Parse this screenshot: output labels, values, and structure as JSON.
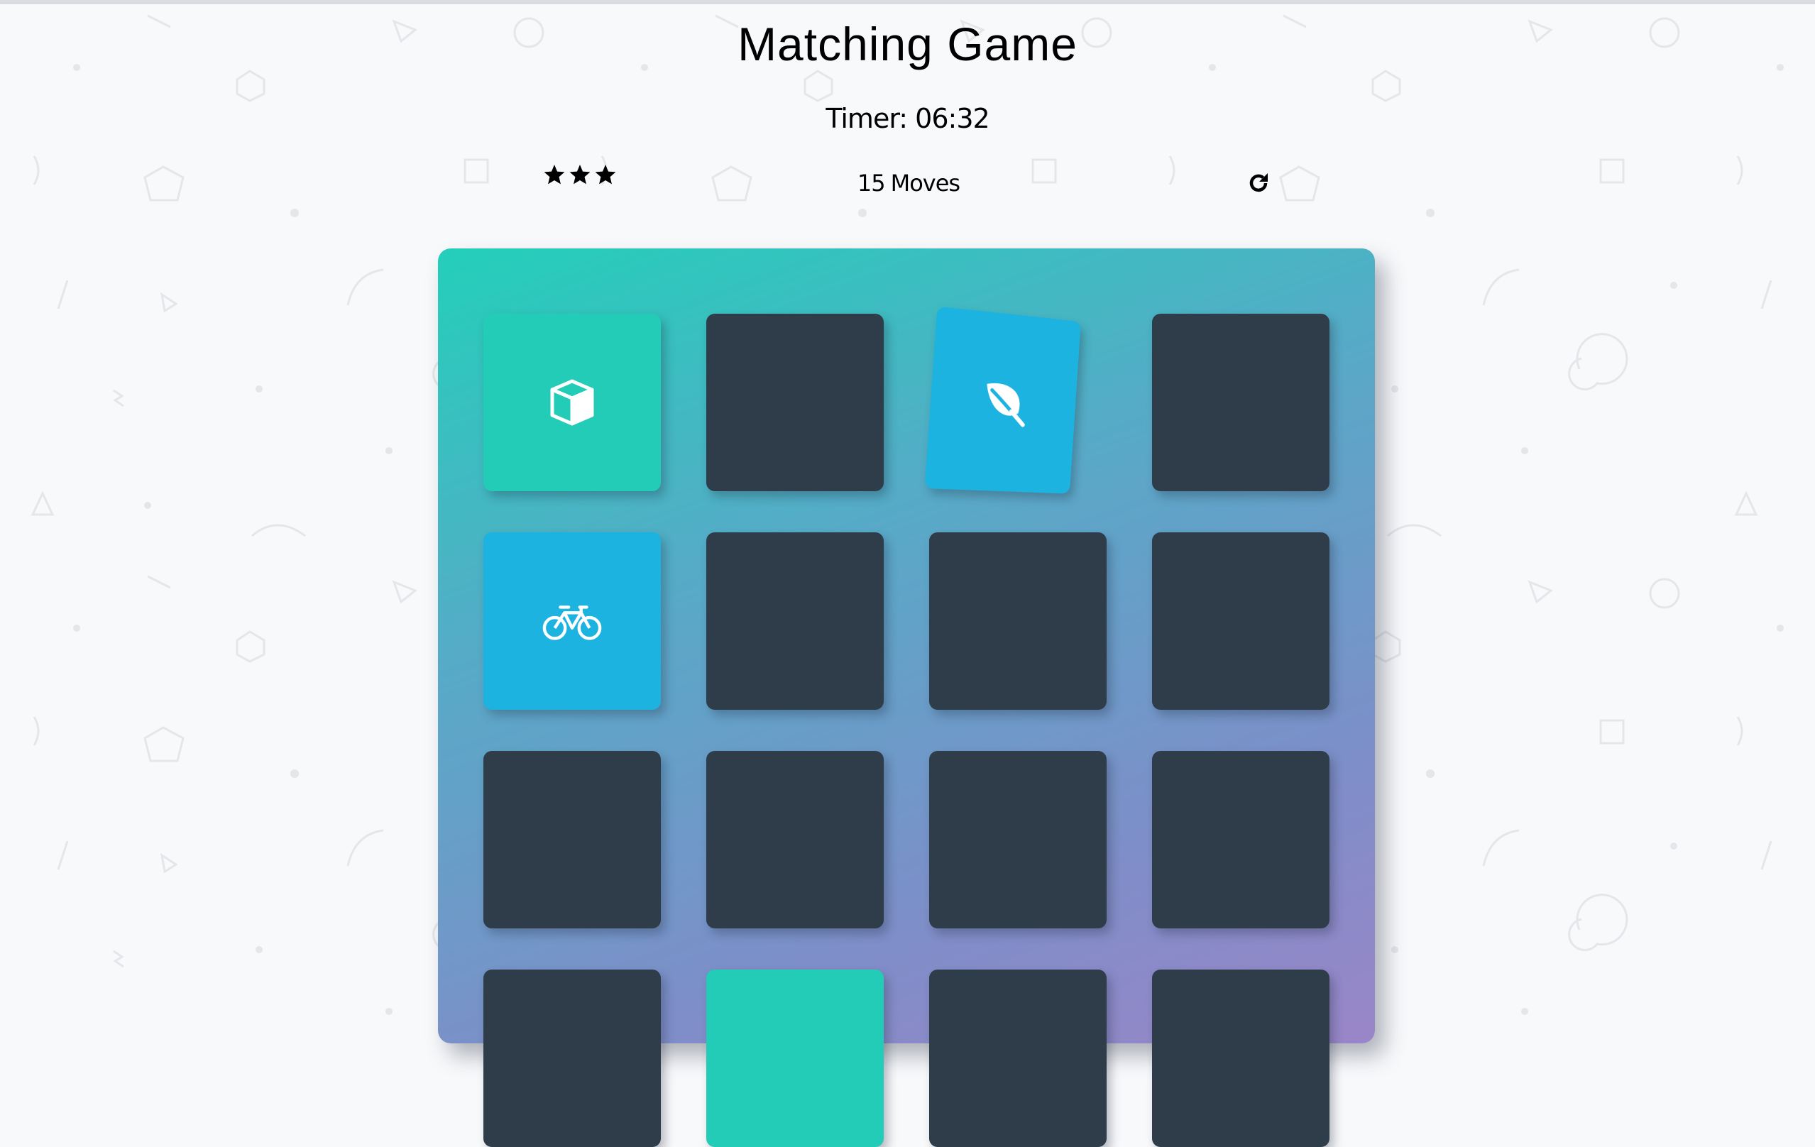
{
  "header": {
    "title": "Matching Game"
  },
  "timer": {
    "label": "Timer: 06:32"
  },
  "score_panel": {
    "stars": [
      {
        "icon": "star-icon",
        "filled": true
      },
      {
        "icon": "star-icon",
        "filled": true
      },
      {
        "icon": "star-icon",
        "filled": true
      }
    ],
    "moves_count": "15",
    "moves_label": "Moves",
    "restart_icon": "repeat-icon"
  },
  "colors": {
    "card_back": "#2e3d49",
    "card_match": "#22ccb6",
    "card_open": "#1db3e1",
    "deck_gradient_start": "#23cfba",
    "deck_gradient_end": "#9a86c8",
    "background": "#f8f9fb"
  },
  "deck": {
    "rows": [
      [
        {
          "state": "match",
          "icon": "cube-icon"
        },
        {
          "state": "closed",
          "icon": ""
        },
        {
          "state": "open",
          "icon": "leaf-icon"
        },
        {
          "state": "closed",
          "icon": ""
        }
      ],
      [
        {
          "state": "open",
          "icon": "bicycle-icon"
        },
        {
          "state": "closed",
          "icon": ""
        },
        {
          "state": "closed",
          "icon": ""
        },
        {
          "state": "closed",
          "icon": ""
        }
      ],
      [
        {
          "state": "closed",
          "icon": ""
        },
        {
          "state": "closed",
          "icon": ""
        },
        {
          "state": "closed",
          "icon": ""
        },
        {
          "state": "closed",
          "icon": ""
        }
      ],
      [
        {
          "state": "closed",
          "icon": ""
        },
        {
          "state": "match",
          "icon": ""
        },
        {
          "state": "closed",
          "icon": ""
        },
        {
          "state": "closed",
          "icon": ""
        }
      ]
    ]
  }
}
